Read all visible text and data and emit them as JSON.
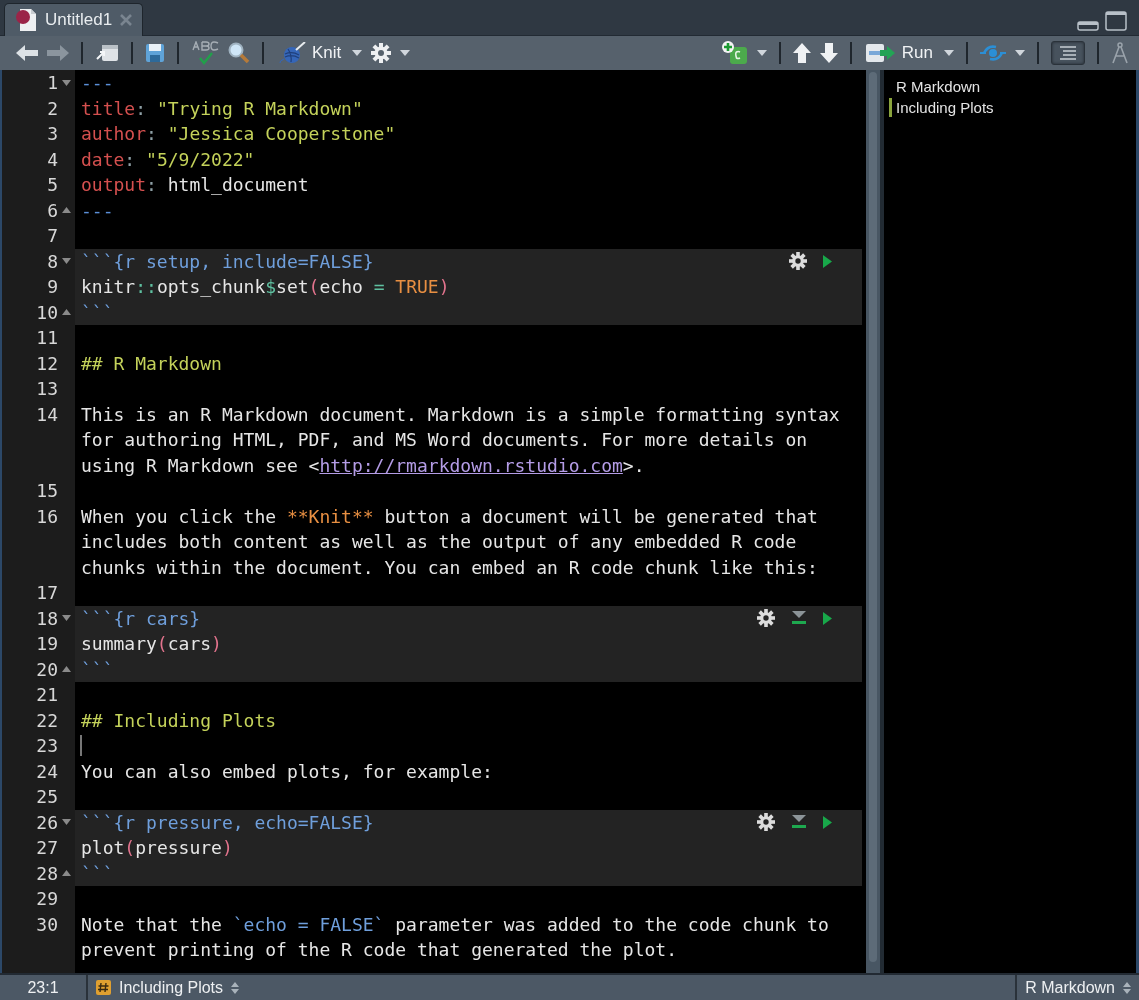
{
  "tab": {
    "title": "Untitled1",
    "selected": true
  },
  "toolbar": {
    "knit_label": "Knit",
    "run_label": "Run",
    "outline_toggle_on": true
  },
  "editor": {
    "lines": [
      {
        "number": "1",
        "fold_start": true,
        "fold_end": false,
        "chunk": false,
        "cursor": false,
        "rows": [
          [
            {
              "kind": "delim",
              "text": "---"
            }
          ]
        ]
      },
      {
        "number": "2",
        "fold_start": false,
        "fold_end": false,
        "chunk": false,
        "cursor": false,
        "rows": [
          [
            {
              "kind": "key",
              "text": "title"
            },
            {
              "kind": "punct",
              "text": ": "
            },
            {
              "kind": "string",
              "text": "\"Trying R Markdown\""
            }
          ]
        ]
      },
      {
        "number": "3",
        "fold_start": false,
        "fold_end": false,
        "chunk": false,
        "cursor": false,
        "rows": [
          [
            {
              "kind": "key",
              "text": "author"
            },
            {
              "kind": "punct",
              "text": ": "
            },
            {
              "kind": "string",
              "text": "\"Jessica Cooperstone\""
            }
          ]
        ]
      },
      {
        "number": "4",
        "fold_start": false,
        "fold_end": false,
        "chunk": false,
        "cursor": false,
        "rows": [
          [
            {
              "kind": "key",
              "text": "date"
            },
            {
              "kind": "punct",
              "text": ": "
            },
            {
              "kind": "string",
              "text": "\"5/9/2022\""
            }
          ]
        ]
      },
      {
        "number": "5",
        "fold_start": false,
        "fold_end": false,
        "chunk": false,
        "cursor": false,
        "rows": [
          [
            {
              "kind": "key",
              "text": "output"
            },
            {
              "kind": "punct",
              "text": ": "
            },
            {
              "kind": "plain",
              "text": "html_document"
            }
          ]
        ]
      },
      {
        "number": "6",
        "fold_start": false,
        "fold_end": true,
        "chunk": false,
        "cursor": false,
        "rows": [
          [
            {
              "kind": "delim",
              "text": "---"
            }
          ]
        ]
      },
      {
        "number": "7",
        "fold_start": false,
        "fold_end": false,
        "chunk": false,
        "cursor": false,
        "rows": [
          []
        ]
      },
      {
        "number": "8",
        "fold_start": true,
        "fold_end": false,
        "chunk": true,
        "cursor": false,
        "header": true,
        "run_previous": false,
        "rows": [
          [
            {
              "kind": "chunk",
              "text": "```{r setup, include=FALSE}"
            }
          ]
        ]
      },
      {
        "number": "9",
        "fold_start": false,
        "fold_end": false,
        "chunk": true,
        "cursor": false,
        "rows": [
          [
            {
              "kind": "plain",
              "text": "knitr"
            },
            {
              "kind": "op",
              "text": "::"
            },
            {
              "kind": "plain",
              "text": "opts_chunk"
            },
            {
              "kind": "op",
              "text": "$"
            },
            {
              "kind": "plain",
              "text": "set"
            },
            {
              "kind": "paren",
              "text": "("
            },
            {
              "kind": "plain",
              "text": "echo "
            },
            {
              "kind": "op",
              "text": "="
            },
            {
              "kind": "plain",
              "text": " "
            },
            {
              "kind": "constant",
              "text": "TRUE"
            },
            {
              "kind": "paren",
              "text": ")"
            }
          ]
        ]
      },
      {
        "number": "10",
        "fold_start": false,
        "fold_end": true,
        "chunk": true,
        "cursor": false,
        "rows": [
          [
            {
              "kind": "chunk",
              "text": "```"
            }
          ]
        ]
      },
      {
        "number": "11",
        "fold_start": false,
        "fold_end": false,
        "chunk": false,
        "cursor": false,
        "rows": [
          []
        ]
      },
      {
        "number": "12",
        "fold_start": false,
        "fold_end": false,
        "chunk": false,
        "cursor": false,
        "rows": [
          [
            {
              "kind": "heading",
              "text": "## R Markdown"
            }
          ]
        ]
      },
      {
        "number": "13",
        "fold_start": false,
        "fold_end": false,
        "chunk": false,
        "cursor": false,
        "rows": [
          []
        ]
      },
      {
        "number": "14",
        "fold_start": false,
        "fold_end": false,
        "chunk": false,
        "cursor": false,
        "rows": [
          [
            {
              "kind": "plain",
              "text": "This is an R Markdown document. Markdown is a simple formatting syntax"
            }
          ],
          [
            {
              "kind": "plain",
              "text": "for authoring HTML, PDF, and MS Word documents. For more details on"
            }
          ],
          [
            {
              "kind": "plain",
              "text": "using R Markdown see <"
            },
            {
              "kind": "link",
              "text": "http://rmarkdown.rstudio.com"
            },
            {
              "kind": "plain",
              "text": ">."
            }
          ]
        ]
      },
      {
        "number": "15",
        "fold_start": false,
        "fold_end": false,
        "chunk": false,
        "cursor": false,
        "rows": [
          []
        ]
      },
      {
        "number": "16",
        "fold_start": false,
        "fold_end": false,
        "chunk": false,
        "cursor": false,
        "rows": [
          [
            {
              "kind": "plain",
              "text": "When you click the "
            },
            {
              "kind": "bold",
              "text": "**Knit**"
            },
            {
              "kind": "plain",
              "text": " button a document will be generated that"
            }
          ],
          [
            {
              "kind": "plain",
              "text": "includes both content as well as the output of any embedded R code"
            }
          ],
          [
            {
              "kind": "plain",
              "text": "chunks within the document. You can embed an R code chunk like this:"
            }
          ]
        ]
      },
      {
        "number": "17",
        "fold_start": false,
        "fold_end": false,
        "chunk": false,
        "cursor": false,
        "rows": [
          []
        ]
      },
      {
        "number": "18",
        "fold_start": true,
        "fold_end": false,
        "chunk": true,
        "cursor": false,
        "header": true,
        "run_previous": true,
        "rows": [
          [
            {
              "kind": "chunk",
              "text": "```{r cars}"
            }
          ]
        ]
      },
      {
        "number": "19",
        "fold_start": false,
        "fold_end": false,
        "chunk": true,
        "cursor": false,
        "rows": [
          [
            {
              "kind": "plain",
              "text": "summary"
            },
            {
              "kind": "paren",
              "text": "("
            },
            {
              "kind": "plain",
              "text": "cars"
            },
            {
              "kind": "paren",
              "text": ")"
            }
          ]
        ]
      },
      {
        "number": "20",
        "fold_start": false,
        "fold_end": true,
        "chunk": true,
        "cursor": false,
        "rows": [
          [
            {
              "kind": "chunk",
              "text": "```"
            }
          ]
        ]
      },
      {
        "number": "21",
        "fold_start": false,
        "fold_end": false,
        "chunk": false,
        "cursor": false,
        "rows": [
          []
        ]
      },
      {
        "number": "22",
        "fold_start": false,
        "fold_end": false,
        "chunk": false,
        "cursor": false,
        "rows": [
          [
            {
              "kind": "heading",
              "text": "## Including Plots"
            }
          ]
        ]
      },
      {
        "number": "23",
        "fold_start": false,
        "fold_end": false,
        "chunk": false,
        "cursor": true,
        "rows": [
          []
        ]
      },
      {
        "number": "24",
        "fold_start": false,
        "fold_end": false,
        "chunk": false,
        "cursor": false,
        "rows": [
          [
            {
              "kind": "plain",
              "text": "You can also embed plots, for example:"
            }
          ]
        ]
      },
      {
        "number": "25",
        "fold_start": false,
        "fold_end": false,
        "chunk": false,
        "cursor": false,
        "rows": [
          []
        ]
      },
      {
        "number": "26",
        "fold_start": true,
        "fold_end": false,
        "chunk": true,
        "cursor": false,
        "header": true,
        "run_previous": true,
        "rows": [
          [
            {
              "kind": "chunk",
              "text": "```{r pressure, echo=FALSE}"
            }
          ]
        ]
      },
      {
        "number": "27",
        "fold_start": false,
        "fold_end": false,
        "chunk": true,
        "cursor": false,
        "rows": [
          [
            {
              "kind": "plain",
              "text": "plot"
            },
            {
              "kind": "paren",
              "text": "("
            },
            {
              "kind": "plain",
              "text": "pressure"
            },
            {
              "kind": "paren",
              "text": ")"
            }
          ]
        ]
      },
      {
        "number": "28",
        "fold_start": false,
        "fold_end": true,
        "chunk": true,
        "cursor": false,
        "rows": [
          [
            {
              "kind": "chunk",
              "text": "```"
            }
          ]
        ]
      },
      {
        "number": "29",
        "fold_start": false,
        "fold_end": false,
        "chunk": false,
        "cursor": false,
        "rows": [
          []
        ]
      },
      {
        "number": "30",
        "fold_start": false,
        "fold_end": false,
        "chunk": false,
        "cursor": false,
        "rows": [
          [
            {
              "kind": "plain",
              "text": "Note that the "
            },
            {
              "kind": "chunk",
              "text": "`echo = FALSE`"
            },
            {
              "kind": "plain",
              "text": " parameter was added to the code chunk to"
            }
          ],
          [
            {
              "kind": "plain",
              "text": "prevent printing of the R code that generated the plot."
            }
          ]
        ]
      }
    ]
  },
  "outline": {
    "items": [
      {
        "label": "R Markdown",
        "selected": false
      },
      {
        "label": "Including Plots",
        "selected": true
      }
    ]
  },
  "status_bar": {
    "position": "23:1",
    "section": "Including Plots",
    "file_type": "R Markdown"
  }
}
